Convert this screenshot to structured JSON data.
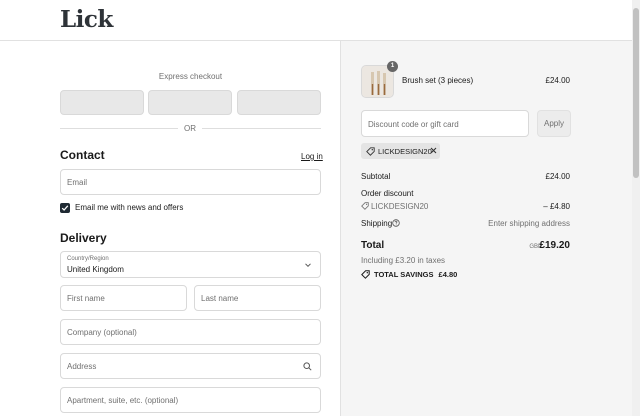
{
  "brand": {
    "logo_text": "Lick"
  },
  "express": {
    "title": "Express checkout",
    "or_label": "OR"
  },
  "contact": {
    "title": "Contact",
    "login_link": "Log in",
    "email_placeholder": "Email",
    "newsletter_label": "Email me with news and offers",
    "newsletter_checked": true
  },
  "delivery": {
    "title": "Delivery",
    "country_label": "Country/Region",
    "country_value": "United Kingdom",
    "first_name_placeholder": "First name",
    "last_name_placeholder": "Last name",
    "company_placeholder": "Company (optional)",
    "address_placeholder": "Address",
    "apartment_placeholder": "Apartment, suite, etc. (optional)"
  },
  "summary": {
    "product": {
      "name": "Brush set (3 pieces)",
      "price": "£24.00",
      "quantity": "1"
    },
    "discount_placeholder": "Discount code or gift card",
    "apply_label": "Apply",
    "applied_code": "LICKDESIGN20",
    "subtotal_label": "Subtotal",
    "subtotal_value": "£24.00",
    "order_discount_label": "Order discount",
    "discount_code": "LICKDESIGN20",
    "discount_value": "– £4.80",
    "shipping_label": "Shipping",
    "shipping_value": "Enter shipping address",
    "total_label": "Total",
    "total_currency": "GBP",
    "total_value": "£19.20",
    "taxes_note": "Including £3.20 in taxes",
    "savings_label": "TOTAL SAVINGS",
    "savings_value": "£4.80"
  },
  "colors": {
    "accent": "#1f2a33",
    "summary_bg": "#f5f5f5",
    "border": "#d9d9d9"
  }
}
